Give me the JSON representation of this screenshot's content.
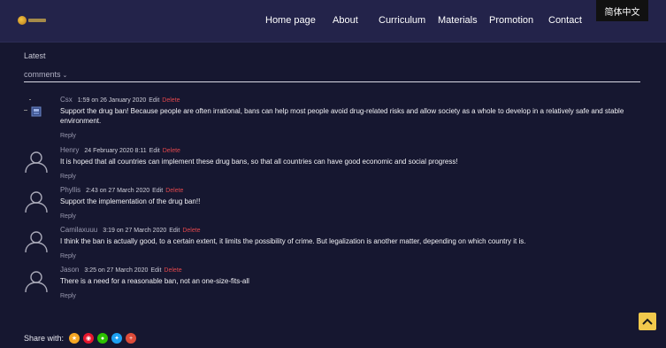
{
  "header": {
    "nav": [
      {
        "label": "Home page"
      },
      {
        "label": "About"
      },
      {
        "label": "Curriculum"
      },
      {
        "label": "Materials"
      },
      {
        "label": "Promotion"
      },
      {
        "label": "Contact"
      }
    ],
    "language_button": "简体中文"
  },
  "section": {
    "latest_label": "Latest",
    "sort_label": "comments",
    "sort_icon": "chevron-down-icon"
  },
  "comments": [
    {
      "author": "Csx",
      "date": "1:59 on 26 January 2020",
      "edit": "Edit",
      "delete": "Delete",
      "text": "Support the drug ban! Because people are often irrational, bans can help most people avoid drug-related risks and allow society as a whole to develop in a relatively safe and stable environment.",
      "reply": "Reply",
      "avatar": "image-avatar"
    },
    {
      "author": "Henry",
      "date": "24 February 2020 8:11",
      "edit": "Edit",
      "delete": "Delete",
      "text": "It is hoped that all countries can implement these drug bans, so that all countries can have good economic and social progress!",
      "reply": "Reply",
      "avatar": "user-silhouette-icon"
    },
    {
      "author": "Phyllis",
      "date": "2:43 on 27 March 2020",
      "edit": "Edit",
      "delete": "Delete",
      "text": "Support the implementation of the drug ban!!",
      "reply": "Reply",
      "avatar": "user-silhouette-icon"
    },
    {
      "author": "Camilaxuuu",
      "date": "3:19 on 27 March 2020",
      "edit": "Edit",
      "delete": "Delete",
      "text": "I think the ban is actually good, to a certain extent, it limits the possibility of crime. But legalization is another matter, depending on which country it is.",
      "reply": "Reply",
      "avatar": "user-silhouette-icon"
    },
    {
      "author": "Jason",
      "date": "3:25 on 27 March 2020",
      "edit": "Edit",
      "delete": "Delete",
      "text": "There is a need for a reasonable ban, not an one-size-fits-all",
      "reply": "Reply",
      "avatar": "user-silhouette-icon"
    }
  ],
  "share": {
    "label": "Share with:",
    "icons": [
      {
        "name": "qzone-icon",
        "color": "#f5a623"
      },
      {
        "name": "weibo-icon",
        "color": "#e6162d"
      },
      {
        "name": "wechat-icon",
        "color": "#2dc100"
      },
      {
        "name": "twitter-icon",
        "color": "#1da1f2"
      },
      {
        "name": "google-plus-icon",
        "color": "#dd4b39"
      }
    ]
  },
  "back_to_top_icon": "chevron-up-icon",
  "colors": {
    "background": "#161730",
    "header": "#23234a",
    "delete": "#e0474c",
    "back_to_top": "#f2c94c"
  }
}
